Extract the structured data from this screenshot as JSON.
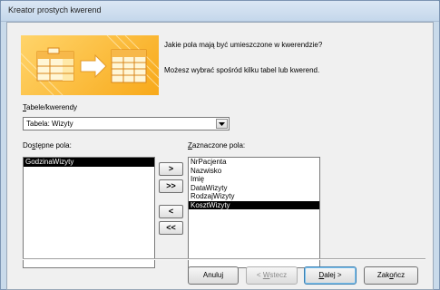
{
  "window": {
    "title": "Kreator prostych kwerend"
  },
  "header": {
    "question": "Jakie pola mają być umieszczone w kwerendzie?",
    "hint": "Możesz wybrać spośród kilku tabel lub kwerend."
  },
  "tables": {
    "label_key": "T",
    "label_rest": "abele/kwerendy",
    "selected": "Tabela: Wizyty"
  },
  "available": {
    "label_pre": "Do",
    "label_key": "s",
    "label_post": "tępne pola:",
    "items": [
      "GodzinaWizyty"
    ]
  },
  "selected_fields": {
    "label_key": "Z",
    "label_rest": "aznaczone pola:",
    "items": [
      "NrPacjenta",
      "Nazwisko",
      "Imię",
      "DataWizyty",
      "RodzajWizyty",
      "KosztWizyty"
    ]
  },
  "move_buttons": {
    "add_one": ">",
    "add_all": ">>",
    "remove_one": "<",
    "remove_all": "<<"
  },
  "buttons": {
    "cancel": "Anuluj",
    "back_prefix": "< ",
    "back_key": "W",
    "back_rest": "stecz",
    "next_key": "D",
    "next_rest": "alej >",
    "finish_pre": "Zak",
    "finish_key": "o",
    "finish_post": "ńcz"
  }
}
